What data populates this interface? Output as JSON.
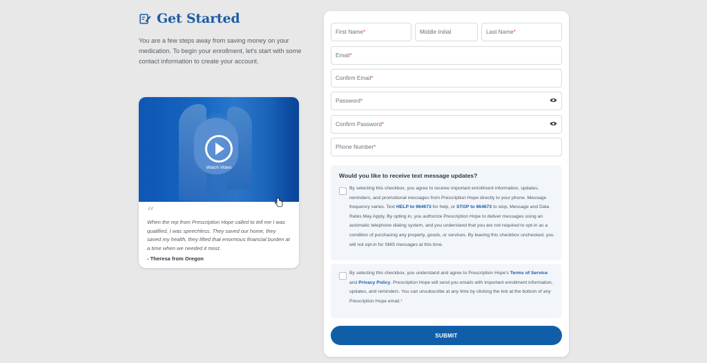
{
  "header": {
    "title": "Get Started",
    "icon": "edit-note-icon",
    "intro": "You are a few steps away from saving money on your medication. To begin your enrollment, let's start with some contact information to create your account."
  },
  "video": {
    "watch_label": "Watch Video",
    "quote": "When the rep from Prescription Hope called to tell me I was qualified, I was speechless. They saved our home, they saved my health, they lifted that enormous financial burden at a time when we needed it most.",
    "author": "- Theresa from Oregon"
  },
  "form": {
    "first_name": "First Name",
    "middle_initial": "Middle Initial",
    "last_name": "Last Name",
    "email": "Email",
    "confirm_email": "Confirm Email",
    "password": "Password",
    "confirm_password": "Confirm Password",
    "phone": "Phone Number",
    "required_mark": "*",
    "sms_title": "Would you like to receive text message updates?",
    "sms_text_1": "By selecting this checkbox, you agree to receive important enrollment information, updates, reminders, and promotional messages from Prescription Hope directly to your phone. Message frequency varies. Text ",
    "sms_help": "HELP to 964673",
    "sms_text_2": " for help, or ",
    "sms_stop": "STOP to 964673",
    "sms_text_3": " to stop, Message and Data Rates May Apply. By opting in, you authorize Prescription Hope to deliver messages using an automatic telephone dialing system, and you understand that you are not required to opt-in as a condition of purchasing any property, goods, or services. By leaving this checkbox unchecked, you will not opt-in for SMS messages at this time.",
    "email_text_1": "By selecting this checkbox, you understand and agree to Prescription Hope's ",
    "terms": "Terms of Service",
    "email_and": " and ",
    "privacy": "Privacy Policy",
    "email_text_2": ". Prescription Hope will send you emails with important enrollment information, updates, and reminders. You can unsubscribe at any time by clicking the link at the bottom of any Prescription Hope email.",
    "submit": "SUBMIT"
  },
  "colors": {
    "brand": "#115ea8",
    "required": "#d64b3c"
  }
}
